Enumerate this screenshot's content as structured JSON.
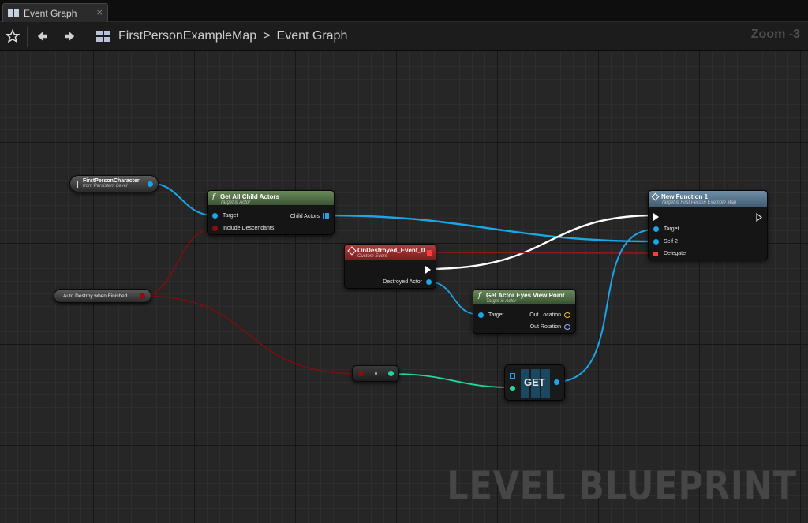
{
  "tab": {
    "title": "Event Graph",
    "close": "×",
    "icon": "graph-icon"
  },
  "toolbar": {
    "favorite_icon": "star-icon",
    "back_icon": "arrow-left-icon",
    "forward_icon": "arrow-right-icon",
    "breadcrumb": {
      "map": "FirstPersonExampleMap",
      "separator": ">",
      "graph": "Event Graph"
    },
    "zoom": "Zoom -3"
  },
  "watermark": "LEVEL BLUEPRINT",
  "nodes": {
    "first_person_character": {
      "title": "FirstPersonCharacter",
      "subtitle": "from Persistent Level"
    },
    "get_all_child_actors": {
      "title": "Get All Child Actors",
      "subtitle": "Target is Actor",
      "pins": {
        "target": "Target",
        "include_descendants": "Include Descendants",
        "child_actors": "Child Actors"
      }
    },
    "new_function": {
      "title": "New Function 1",
      "subtitle": "Target is First Person Example Map",
      "pins": {
        "target": "Target",
        "self": "Self 2",
        "delegate": "Delegate"
      }
    },
    "on_destroyed": {
      "title": "OnDestroyed_Event_0",
      "subtitle": "Custom Event",
      "pins": {
        "destroyed_actor": "Destroyed Actor"
      }
    },
    "get_actor_eyes": {
      "title": "Get Actor Eyes View Point",
      "subtitle": "Target is Actor",
      "pins": {
        "target": "Target",
        "out_location": "Out Location",
        "out_rotation": "Out Rotation"
      }
    },
    "auto_destroy": {
      "title": "Auto Destroy when Finished"
    },
    "get": {
      "title": "GET"
    }
  },
  "colors": {
    "object_pin": "#1aa6e8",
    "bool_pin": "#8e0c0c",
    "int_pin": "#1fd8a0",
    "exec_pin": "#ffffff",
    "delegate_pin": "#ff3b3b",
    "vector_pin": "#f0c22a",
    "rotator_pin": "#9fb6ff"
  }
}
